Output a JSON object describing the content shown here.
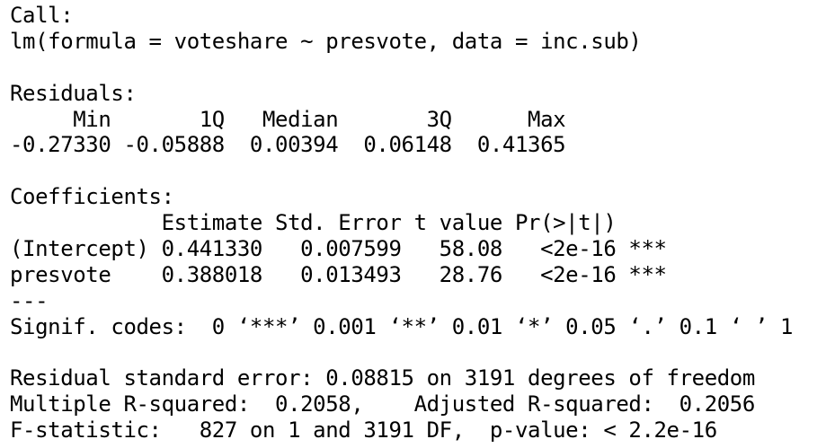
{
  "console": {
    "call_label": "Call:",
    "call_formula": "lm(formula = voteshare ~ presvote, data = inc.sub)",
    "residuals_label": "Residuals:",
    "residuals_header": "     Min       1Q   Median       3Q      Max ",
    "residuals_values": "-0.27330 -0.05888  0.00394  0.06148  0.41365 ",
    "coefficients_label": "Coefficients:",
    "coef_header": "            Estimate Std. Error t value Pr(>|t|)    ",
    "coef_intercept": "(Intercept) 0.441330   0.007599   58.08   <2e-16 ***",
    "coef_presvote": "presvote    0.388018   0.013493   28.76   <2e-16 ***",
    "separator": "---",
    "signif_codes": "Signif. codes:  0 ‘***’ 0.001 ‘**’ 0.01 ‘*’ 0.05 ‘.’ 0.1 ‘ ’ 1",
    "residual_se": "Residual standard error: 0.08815 on 3191 degrees of freedom",
    "r_squared": "Multiple R-squared:  0.2058,\tAdjusted R-squared:  0.2056 ",
    "f_statistic": "F-statistic:   827 on 1 and 3191 DF,  p-value: < 2.2e-16"
  }
}
